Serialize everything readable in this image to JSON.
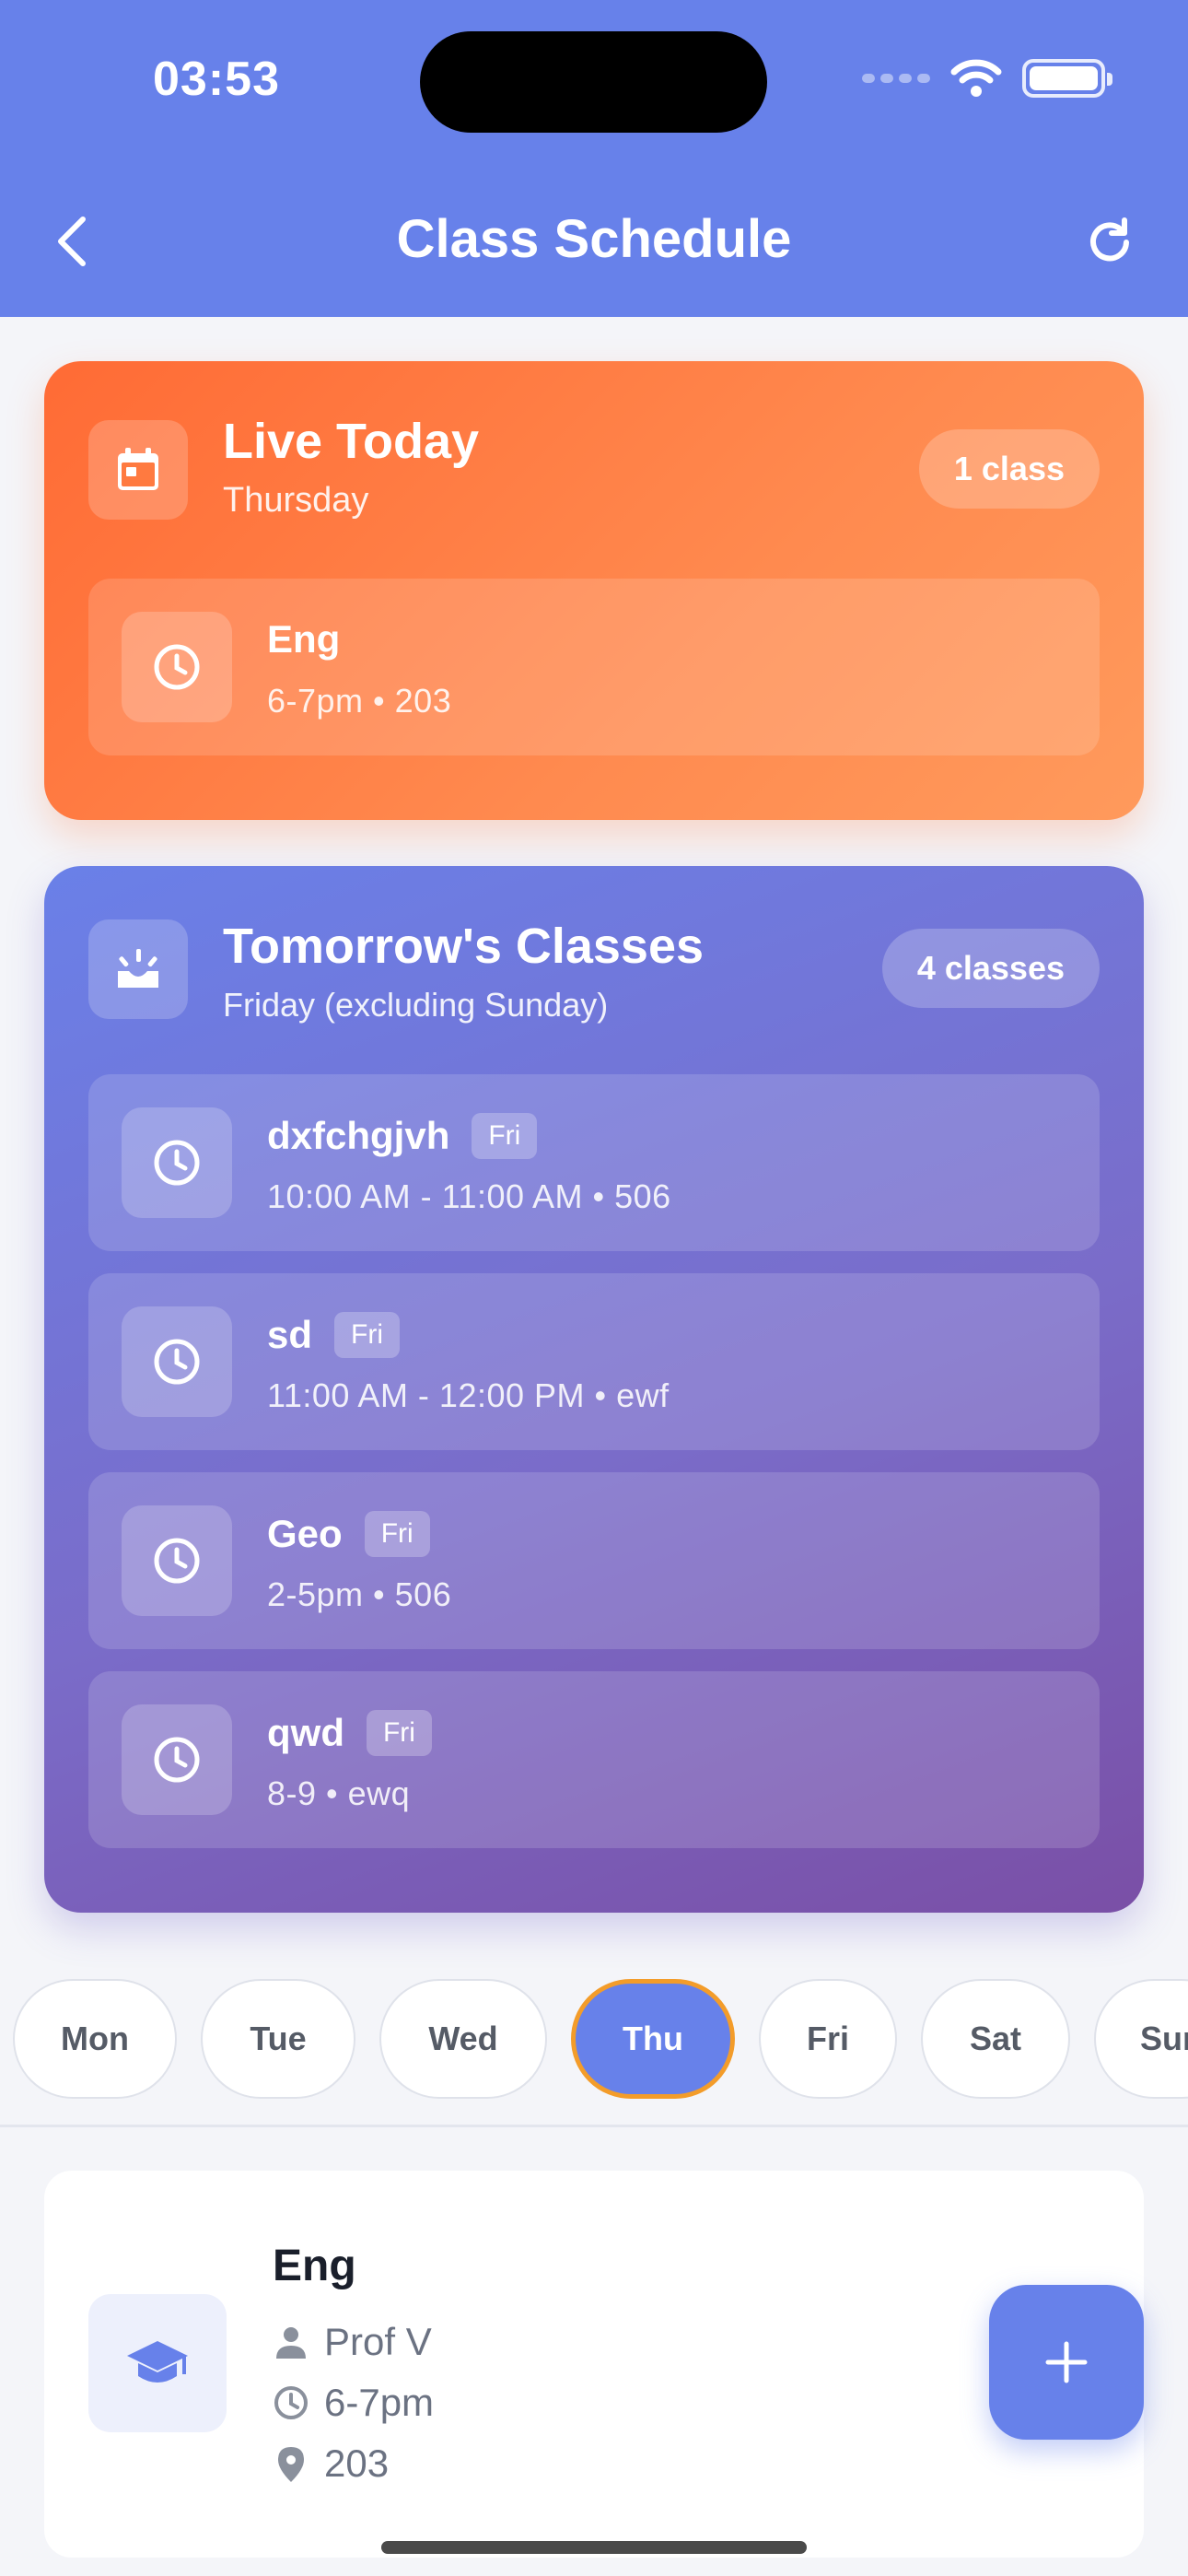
{
  "status_bar": {
    "time": "03:53"
  },
  "header": {
    "title": "Class Schedule"
  },
  "today": {
    "title": "Live Today",
    "subtitle": "Thursday",
    "badge": "1 class",
    "items": [
      {
        "name": "Eng",
        "meta": "6-7pm • 203"
      }
    ]
  },
  "tomorrow": {
    "title": "Tomorrow's Classes",
    "subtitle": "Friday (excluding Sunday)",
    "badge": "4 classes",
    "items": [
      {
        "name": "dxfchgjvh",
        "tag": "Fri",
        "meta": "10:00 AM - 11:00 AM • 506"
      },
      {
        "name": "sd",
        "tag": "Fri",
        "meta": "11:00 AM - 12:00 PM • ewf"
      },
      {
        "name": "Geo",
        "tag": "Fri",
        "meta": "2-5pm • 506"
      },
      {
        "name": "qwd",
        "tag": "Fri",
        "meta": "8-9 • ewq"
      }
    ]
  },
  "days": [
    "Mon",
    "Tue",
    "Wed",
    "Thu",
    "Fri",
    "Sat",
    "Sun"
  ],
  "selected_day": "Thu",
  "class_card": {
    "name": "Eng",
    "professor": "Prof V",
    "time": "6-7pm",
    "room": "203"
  },
  "colors": {
    "primary": "#6781ea",
    "today_gradient_start": "#ff6b35",
    "tomorrow_gradient_end": "#7a4fa6",
    "active_day_border": "#f39c2a"
  }
}
